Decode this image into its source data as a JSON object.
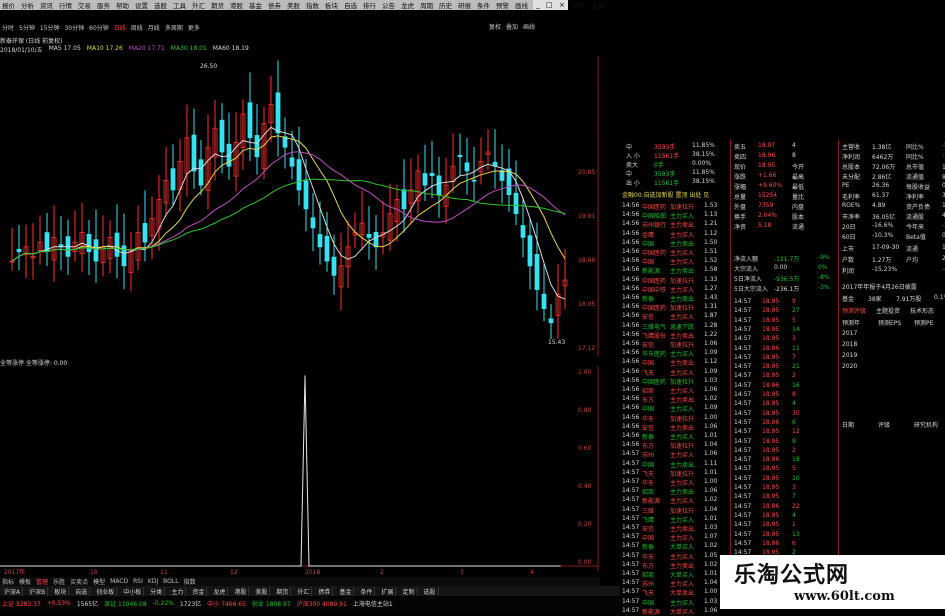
{
  "menu": {
    "items": [
      "报价",
      "分析",
      "资讯",
      "行情",
      "交易",
      "服务",
      "帮助",
      "设置",
      "选股",
      "工具",
      "外汇",
      "期货",
      "港股",
      "基金",
      "债券",
      "美股",
      "指数",
      "板块",
      "自选",
      "排行",
      "公告",
      "龙虎",
      "周期",
      "历史",
      "研报",
      "条件",
      "预警",
      "画线",
      "通达",
      "交易",
      "资讯",
      "工具"
    ],
    "window_buttons": [
      "_",
      "□",
      "×"
    ]
  },
  "periods": {
    "items": [
      "分时",
      "5分钟",
      "15分钟",
      "30分钟",
      "60分钟",
      "日线",
      "周线",
      "月线",
      "多周期",
      "更多"
    ],
    "right_tools": [
      "复权",
      "叠加",
      "画线"
    ]
  },
  "chart": {
    "title": "新泰环保 (日线 前复权)",
    "ma_line": [
      {
        "text": "2018/01/10/五",
        "color": "#d8d8d8"
      },
      {
        "text": "MA5 17.05",
        "color": "#d8d8d8"
      },
      {
        "text": "MA10 17.26",
        "color": "#e8d84a"
      },
      {
        "text": "MA20 17.71",
        "color": "#c050c0"
      },
      {
        "text": "MA30 18.01",
        "color": "#2ec62e"
      },
      {
        "text": "MA60 18.19",
        "color": "#d8d8d8"
      }
    ],
    "y_ticks": [
      "20.85",
      "19.91",
      "18.98",
      "18.05",
      "17.12",
      "16.18"
    ],
    "high_label": "26.50",
    "low_label": "15.43",
    "x_labels": [
      "2017年",
      "10",
      "11",
      "12",
      "2018",
      "2",
      "3",
      "4"
    ],
    "sub_title": "全等涨停 全等涨停: 0.00",
    "sub_y_ticks": [
      "1.00",
      "0.80",
      "0.60",
      "0.40",
      "0.20",
      "0.00"
    ],
    "chart_data": {
      "type": "line",
      "title": "全等涨停",
      "x": [
        "2017年",
        "10",
        "11",
        "12",
        "2018",
        "2",
        "3",
        "4"
      ],
      "series": [
        {
          "name": "全等涨停",
          "values": [
            0,
            0,
            0,
            0,
            1,
            0,
            0,
            0
          ]
        }
      ],
      "ylim": [
        0,
        1
      ]
    }
  },
  "tabs": {
    "items": [
      "指标",
      "模板",
      "管理",
      "乐胜",
      "买卖点",
      "模型",
      "MACD",
      "RSI",
      "KDJ",
      "BOLL",
      "指数"
    ],
    "active": 2
  },
  "bottom_tabs": [
    "沪深A",
    "沪深B",
    "板块",
    "自选",
    "创业板",
    "中小板",
    "分类",
    "主力",
    "资金",
    "龙虎",
    "港股",
    "美股",
    "期货",
    "外汇",
    "债券",
    "基金",
    "条件",
    "扩展",
    "定制",
    "选股"
  ],
  "status": [
    {
      "text": "上证 3283.37",
      "cls": "up"
    },
    {
      "text": "+0.53%",
      "cls": "up"
    },
    {
      "text": "1565亿",
      "cls": "wh"
    },
    {
      "text": "深证 11046.08",
      "cls": "dn"
    },
    {
      "text": "-0.22%",
      "cls": "dn"
    },
    {
      "text": "1723亿",
      "cls": "wh"
    },
    {
      "text": "中小 7466.65",
      "cls": "up"
    },
    {
      "text": "创业 1808.97",
      "cls": "dn"
    },
    {
      "text": "沪深300 4089.91",
      "cls": "up"
    },
    {
      "text": "上海电信主站1",
      "cls": "wh"
    }
  ],
  "order_book": {
    "trades": [
      {
        "name": "中",
        "vol": "3593手",
        "pct": "11.85%"
      },
      {
        "name": "入 小",
        "vol": "11561手",
        "pct": "38.15%"
      },
      {
        "name": "卖大",
        "vol": "0手",
        "pct": "0.00%"
      },
      {
        "name": "中",
        "vol": "3593手",
        "pct": "11.85%"
      },
      {
        "name": "出 小",
        "vol": "11561手",
        "pct": "38.15%"
      }
    ],
    "note": "金融00.自选加新股 置顶 出处 见"
  },
  "ticks": [
    {
      "t": "14:56",
      "name": "中国医药",
      "act": "加速拉升",
      "v": "1.53"
    },
    {
      "t": "14:56",
      "name": "中国船舶",
      "act": "主力买入",
      "v": "1.13"
    },
    {
      "t": "14:56",
      "name": "苏州银行",
      "act": "主力卖出",
      "v": "1.21"
    },
    {
      "t": "14:56",
      "name": "金鹰",
      "act": "主力买入",
      "v": "1.12"
    },
    {
      "t": "14:56",
      "name": "中国",
      "act": "主力卖出",
      "v": "1.50"
    },
    {
      "t": "14:56",
      "name": "中国医药",
      "act": "主力买入",
      "v": "1.51"
    },
    {
      "t": "14:56",
      "name": "中国",
      "act": "主力买入",
      "v": "1.52"
    },
    {
      "t": "14:56",
      "name": "新能源",
      "act": "主力卖出",
      "v": "1.58"
    },
    {
      "t": "14:56",
      "name": "中国医药",
      "act": "加速拉升",
      "v": "1.33"
    },
    {
      "t": "14:56",
      "name": "中国中铁",
      "act": "主力买入",
      "v": "1.27"
    },
    {
      "t": "14:56",
      "name": "新泰",
      "act": "主力卖出",
      "v": "1.43"
    },
    {
      "t": "14:56",
      "name": "中国医药",
      "act": "加速拉升",
      "v": "1.31"
    },
    {
      "t": "14:56",
      "name": "安信",
      "act": "主力买入",
      "v": "1.87"
    },
    {
      "t": "14:56",
      "name": "三维电气",
      "act": "急速下跌",
      "v": "1.28"
    },
    {
      "t": "14:56",
      "name": "飞鹰股份",
      "act": "主力卖出",
      "v": "1.22"
    },
    {
      "t": "14:56",
      "name": "安信",
      "act": "加速拉升",
      "v": "1.06"
    },
    {
      "t": "14:56",
      "name": "华东医药",
      "act": "主力买入",
      "v": "1.09"
    },
    {
      "t": "14:56",
      "name": "中国",
      "act": "主力卖出",
      "v": "1.12"
    },
    {
      "t": "14:56",
      "name": "飞天",
      "act": "主力买入",
      "v": "1.09"
    },
    {
      "t": "14:56",
      "name": "中国医药",
      "act": "加速拉升",
      "v": "1.03"
    },
    {
      "t": "14:56",
      "name": "招商",
      "act": "主力买入",
      "v": "1.06"
    },
    {
      "t": "14:56",
      "name": "东方",
      "act": "主力卖出",
      "v": "1.02"
    },
    {
      "t": "14:56",
      "name": "中国",
      "act": "主力买入",
      "v": "1.09"
    },
    {
      "t": "14:56",
      "name": "华东",
      "act": "加速拉升",
      "v": "1.00"
    },
    {
      "t": "14:56",
      "name": "安信",
      "act": "主力卖出",
      "v": "1.06"
    },
    {
      "t": "14:56",
      "name": "新泰",
      "act": "主力买入",
      "v": "1.01"
    },
    {
      "t": "14:56",
      "name": "东方",
      "act": "加速拉升",
      "v": "1.04"
    },
    {
      "t": "14:57",
      "name": "苏州",
      "act": "主力买入",
      "v": "1.06"
    },
    {
      "t": "14:57",
      "name": "中国",
      "act": "主力卖出",
      "v": "1.11"
    },
    {
      "t": "14:57",
      "name": "飞天",
      "act": "加速拉升",
      "v": "1.01"
    },
    {
      "t": "14:57",
      "name": "华东",
      "act": "主力买入",
      "v": "1.00"
    },
    {
      "t": "14:57",
      "name": "招商",
      "act": "主力卖出",
      "v": "1.06"
    },
    {
      "t": "14:57",
      "name": "新能源",
      "act": "主力买入",
      "v": "1.02"
    },
    {
      "t": "14:57",
      "name": "三维",
      "act": "加速拉升",
      "v": "1.04"
    },
    {
      "t": "14:57",
      "name": "飞鹰",
      "act": "主力买入",
      "v": "1.01"
    },
    {
      "t": "14:57",
      "name": "安信",
      "act": "主力卖出",
      "v": "1.03"
    },
    {
      "t": "14:57",
      "name": "中国",
      "act": "主力买入",
      "v": "1.07"
    },
    {
      "t": "14:57",
      "name": "新泰",
      "act": "大单买入",
      "v": "1.02"
    },
    {
      "t": "14:57",
      "name": "华东",
      "act": "主力买入",
      "v": "1.05"
    },
    {
      "t": "14:57",
      "name": "东方",
      "act": "主力卖出",
      "v": "1.02"
    },
    {
      "t": "14:57",
      "name": "招商",
      "act": "大单买入",
      "v": "1.01"
    },
    {
      "t": "14:57",
      "name": "苏州",
      "act": "主力买入",
      "v": "1.04"
    },
    {
      "t": "14:57",
      "name": "飞天",
      "act": "大单卖出",
      "v": "1.00"
    },
    {
      "t": "14:57",
      "name": "中国",
      "act": "主力买入",
      "v": "1.03"
    },
    {
      "t": "14:57",
      "name": "新能源",
      "act": "大单买入",
      "v": "1.06"
    }
  ],
  "quote": {
    "rows": [
      {
        "l": "卖五",
        "v": "18.97",
        "r": "4"
      },
      {
        "l": "卖四",
        "v": "18.96",
        "r": "8"
      },
      {
        "l": "现价",
        "v": "18.95",
        "r": "今开"
      },
      {
        "l": "涨跌",
        "v": "+1.66",
        "r": "最高"
      },
      {
        "l": "涨幅",
        "v": "+9.60%",
        "r": "最低"
      },
      {
        "l": "总量",
        "v": "15254",
        "r": "量比"
      },
      {
        "l": "外盘",
        "v": "7359",
        "r": "内盘"
      },
      {
        "l": "换手",
        "v": "2.04%",
        "r": "股本"
      },
      {
        "l": "净资",
        "v": "5.18",
        "r": "流通"
      }
    ],
    "flows": [
      {
        "l": "净流入额",
        "v": "-121.7万",
        "pct": "-9%"
      },
      {
        "l": "大宗流入",
        "v": "0.00",
        "pct": "0%"
      },
      {
        "l": "5日净流入",
        "v": "-936.5万",
        "pct": "-8%"
      },
      {
        "l": "5日大宗流入",
        "v": "-236.1万",
        "pct": "-3%"
      }
    ],
    "time_ticks": [
      {
        "t": "14:57",
        "p": "18.95",
        "v": "9"
      },
      {
        "t": "14:57",
        "p": "18.95",
        "v": "27"
      },
      {
        "t": "14:57",
        "p": "18.95",
        "v": "5"
      },
      {
        "t": "14:57",
        "p": "18.95",
        "v": "14"
      },
      {
        "t": "14:57",
        "p": "18.95",
        "v": "3"
      },
      {
        "t": "14:57",
        "p": "18.96",
        "v": "11"
      },
      {
        "t": "14:57",
        "p": "18.95",
        "v": "7"
      },
      {
        "t": "14:57",
        "p": "18.95",
        "v": "21"
      },
      {
        "t": "14:57",
        "p": "18.95",
        "v": "2"
      },
      {
        "t": "14:57",
        "p": "18.96",
        "v": "16"
      },
      {
        "t": "14:57",
        "p": "18.95",
        "v": "8"
      },
      {
        "t": "14:57",
        "p": "18.95",
        "v": "4"
      },
      {
        "t": "14:57",
        "p": "18.95",
        "v": "30"
      },
      {
        "t": "14:57",
        "p": "18.96",
        "v": "6"
      },
      {
        "t": "14:57",
        "p": "18.95",
        "v": "12"
      },
      {
        "t": "14:57",
        "p": "18.95",
        "v": "9"
      },
      {
        "t": "14:57",
        "p": "18.95",
        "v": "2"
      },
      {
        "t": "14:57",
        "p": "18.96",
        "v": "18"
      },
      {
        "t": "14:57",
        "p": "18.95",
        "v": "5"
      },
      {
        "t": "14:57",
        "p": "18.95",
        "v": "10"
      },
      {
        "t": "14:57",
        "p": "18.95",
        "v": "3"
      },
      {
        "t": "14:57",
        "p": "18.95",
        "v": "7"
      },
      {
        "t": "14:57",
        "p": "18.96",
        "v": "22"
      },
      {
        "t": "14:57",
        "p": "18.95",
        "v": "4"
      },
      {
        "t": "14:57",
        "p": "18.95",
        "v": "1"
      },
      {
        "t": "14:57",
        "p": "18.95",
        "v": "13"
      },
      {
        "t": "14:57",
        "p": "18.96",
        "v": "6"
      },
      {
        "t": "14:57",
        "p": "18.95",
        "v": "2"
      },
      {
        "t": "14:57",
        "p": "18.95",
        "v": "9"
      },
      {
        "t": "14:57",
        "p": "18.95",
        "v": "15"
      }
    ]
  },
  "fin": {
    "rows": [
      {
        "a": "主营收",
        "b": "1.38亿",
        "c": "同比%",
        "d": "-8.08"
      },
      {
        "a": "净利润",
        "b": "6462万",
        "c": "同比%",
        "d": "-16.35"
      },
      {
        "a": "总股本",
        "b": "72.06万",
        "c": "总市值",
        "d": "19.69亿"
      },
      {
        "a": "未分配",
        "b": "2.86亿",
        "c": "流通值",
        "d": "8963万"
      },
      {
        "a": "PE",
        "b": "26.36",
        "c": "每股收益",
        "d": "0.72"
      },
      {
        "a": "毛利率",
        "b": "61.37",
        "c": "净利率",
        "d": "3.60"
      },
      {
        "a": "ROE%",
        "b": "4.89",
        "c": "资产负债",
        "d": "12.13"
      },
      {
        "a": "市净率",
        "b": "36.05亿",
        "c": "流通股",
        "d": "4.91"
      },
      {
        "a": "20日",
        "b": "-16.6%",
        "c": "今年来",
        "d": "-20.2"
      },
      {
        "a": "60日",
        "b": "-10.3%",
        "c": "Beta值",
        "d": "0.6"
      }
    ],
    "list_date": {
      "a": "上市",
      "b": "17-09-30",
      "c": "流通",
      "d": "17.99"
    },
    "holders": {
      "a": "户数",
      "b": "1.27万",
      "c": "户均",
      "d": "2.6"
    },
    "profit": {
      "a": "利润",
      "b": "-15.23%",
      "c": "",
      "d": "-48.95%"
    },
    "report_note": "2017年年报于4月26日披露",
    "eps_row": {
      "a": "基金",
      "b": "38家",
      "c": "7.91万股",
      "d": "0.1%"
    },
    "tabs": [
      "预测评级",
      "主题投资",
      "技术形态"
    ],
    "forecast_header": [
      "预测年",
      "预测EPS",
      "预测PE"
    ],
    "years": [
      "2017",
      "2018",
      "2019",
      "2020"
    ],
    "bottom": [
      "日期",
      "评级",
      "研究机构"
    ]
  },
  "watermark": {
    "title": "乐淘公式网",
    "url": "www.60lt.com"
  },
  "colors": {
    "up": "#ff4848",
    "down": "#19c22c",
    "bg": "#000000",
    "grid": "#8b1a1a"
  }
}
